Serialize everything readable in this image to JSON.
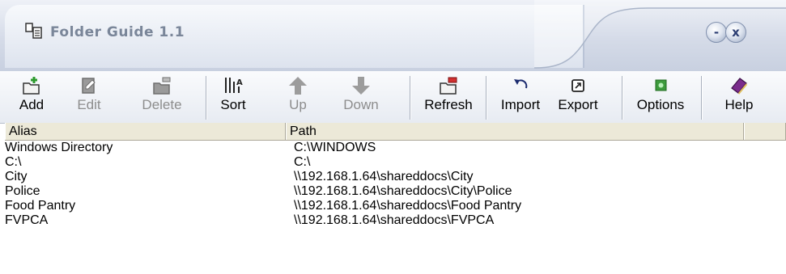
{
  "window": {
    "title": "Folder Guide 1.1",
    "minimize_symbol": "-",
    "close_symbol": "x"
  },
  "toolbar": {
    "items": [
      {
        "label": "Add",
        "icon": "add-folder-icon",
        "enabled": true
      },
      {
        "label": "Edit",
        "icon": "edit-icon",
        "enabled": false
      },
      {
        "label": "Delete",
        "icon": "delete-icon",
        "enabled": false
      },
      {
        "label": "Sort",
        "icon": "sort-icon",
        "enabled": true
      },
      {
        "label": "Up",
        "icon": "arrow-up-icon",
        "enabled": false
      },
      {
        "label": "Down",
        "icon": "arrow-down-icon",
        "enabled": false
      },
      {
        "label": "Refresh",
        "icon": "refresh-icon",
        "enabled": true
      },
      {
        "label": "Import",
        "icon": "import-icon",
        "enabled": true
      },
      {
        "label": "Export",
        "icon": "export-icon",
        "enabled": true
      },
      {
        "label": "Options",
        "icon": "options-icon",
        "enabled": true
      },
      {
        "label": "Help",
        "icon": "help-book-icon",
        "enabled": true
      }
    ]
  },
  "table": {
    "columns": [
      "Alias",
      "Path"
    ],
    "rows": [
      {
        "alias": "Windows Directory",
        "path": "C:\\WINDOWS"
      },
      {
        "alias": "C:\\",
        "path": "C:\\"
      },
      {
        "alias": "City",
        "path": "\\\\192.168.1.64\\shareddocs\\City"
      },
      {
        "alias": "Police",
        "path": "\\\\192.168.1.64\\shareddocs\\City\\Police"
      },
      {
        "alias": "Food Pantry",
        "path": "\\\\192.168.1.64\\shareddocs\\Food Pantry"
      },
      {
        "alias": "FVPCA",
        "path": "\\\\192.168.1.64\\shareddocs\\FVPCA"
      }
    ]
  },
  "colors": {
    "title_text": "#7a8699",
    "header_bg": "#ece9d8",
    "disabled_text": "#8d8d8d"
  }
}
